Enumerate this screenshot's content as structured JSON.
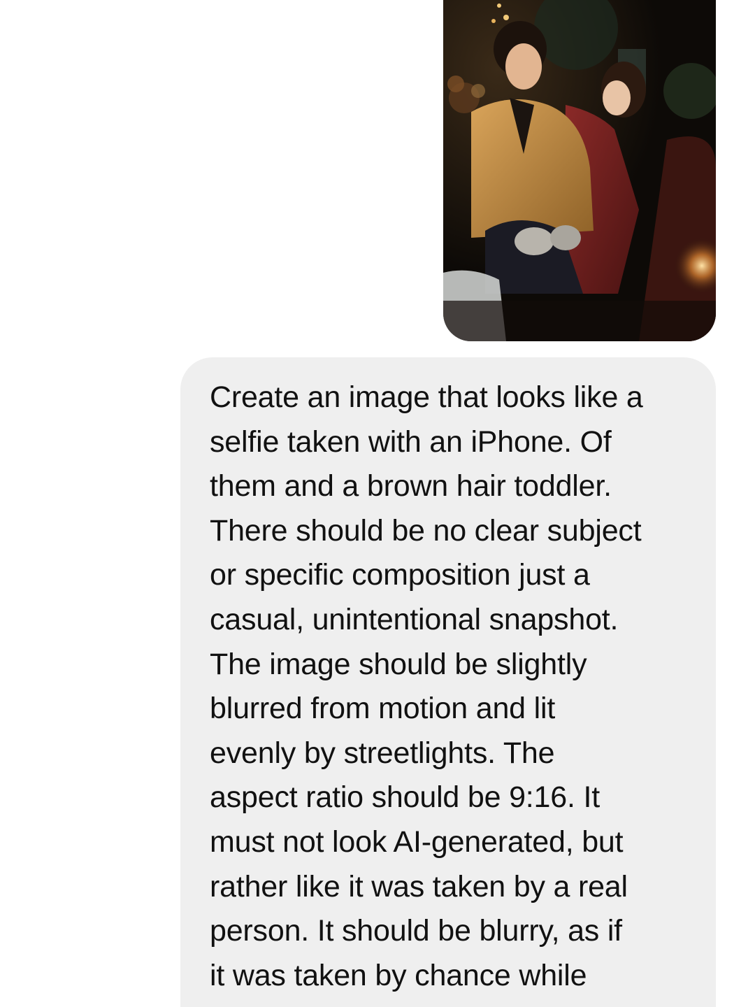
{
  "conversation": {
    "messages": [
      {
        "type": "image",
        "sender": "me",
        "image_icon": "photo-attachment"
      },
      {
        "type": "text",
        "sender": "me",
        "text": "Create an image that looks like a\nselfie taken with an iPhone. Of\nthem and a brown hair toddler.\nThere should be no clear subject\nor specific composition just a\ncasual, unintentional snapshot.\nThe image should be slightly\nblurred from motion and lit\nevenly by streetlights. The\naspect ratio should be 9:16. It\nmust not look AI-generated, but\nrather like it was taken by a real\nperson. It should be blurry, as if\nit was taken by chance while\nthey were having fun."
      }
    ]
  },
  "colors": {
    "bubble_background": "#efefef",
    "text": "#111111",
    "page_background": "#ffffff"
  }
}
